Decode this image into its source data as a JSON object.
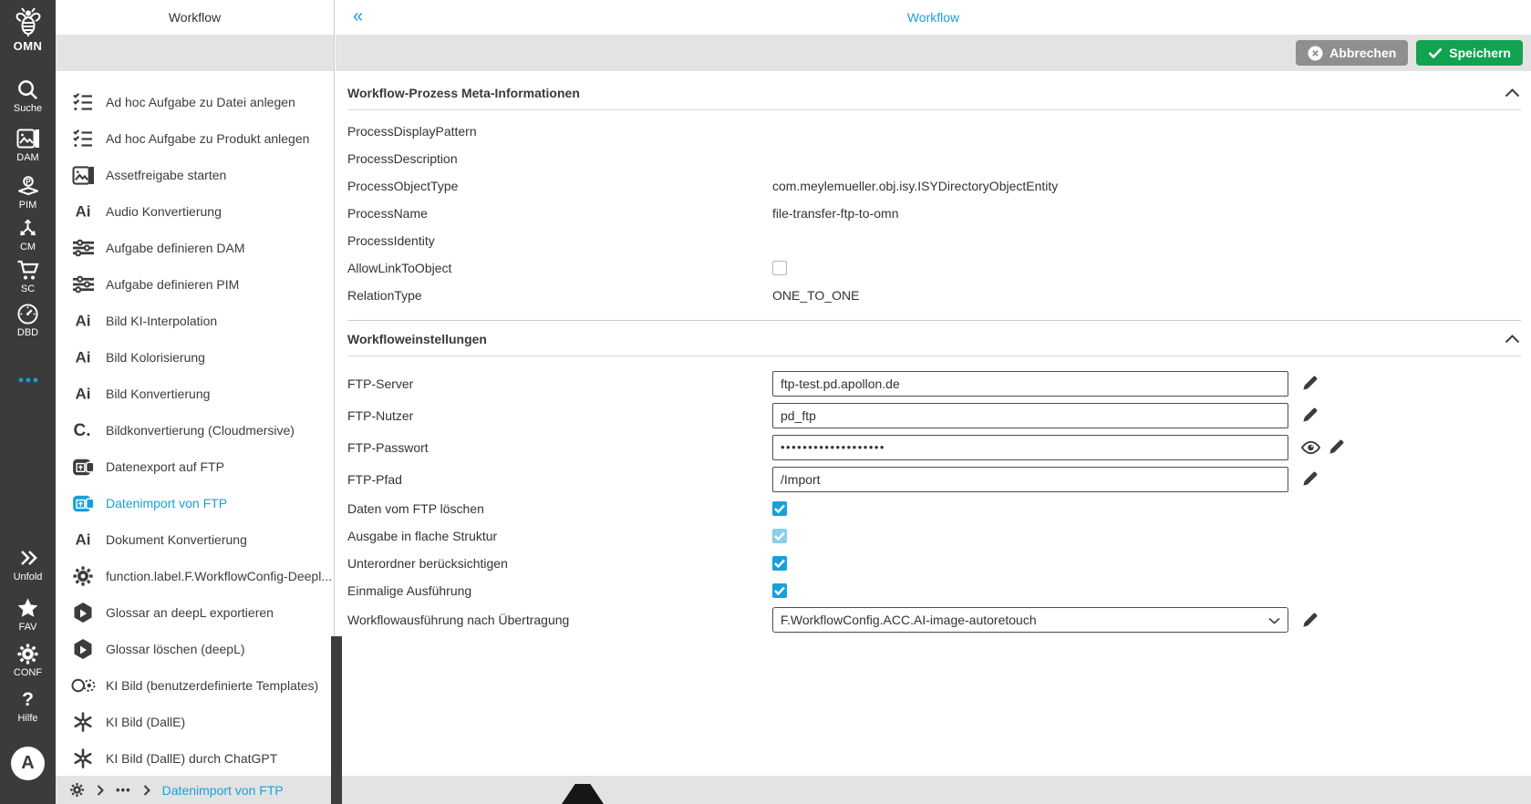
{
  "colors": {
    "accent_blue": "#189fdb",
    "save_green": "#12a350",
    "cancel_gray": "#8f8f8f",
    "sidebar_bg": "#3b3b3b",
    "toolbar_gray": "#e3e3e3",
    "checkbox_blue": "#18a0dc",
    "checkbox_blue_disabled": "#8ccdeb"
  },
  "left_nav": {
    "logo": {
      "icon": "bee-icon",
      "label": "OMN"
    },
    "items": [
      {
        "icon": "search-icon",
        "label": "Suche"
      },
      {
        "icon": "dam-icon",
        "label": "DAM"
      },
      {
        "icon": "pim-icon",
        "label": "PIM"
      },
      {
        "icon": "cm-icon",
        "label": "CM"
      },
      {
        "icon": "cart-icon",
        "label": "SC"
      },
      {
        "icon": "gauge-icon",
        "label": "DBD"
      },
      {
        "icon": "more-dots-icon",
        "label": ""
      }
    ],
    "bottom_items": [
      {
        "icon": "unfold-icon",
        "label": "Unfold"
      },
      {
        "icon": "star-icon",
        "label": "FAV"
      },
      {
        "icon": "gear-icon",
        "label": "CONF"
      },
      {
        "icon": "help-icon",
        "label": "Hilfe"
      }
    ],
    "avatar_letter": "A"
  },
  "workflow_panel": {
    "title": "Workflow",
    "items": [
      {
        "icon": "tasklist-icon",
        "label": "Ad hoc Aufgabe zu Datei anlegen"
      },
      {
        "icon": "tasklist-icon",
        "label": "Ad hoc Aufgabe zu Produkt anlegen"
      },
      {
        "icon": "asset-icon",
        "label": "Assetfreigabe starten"
      },
      {
        "icon": "ai-icon",
        "label": "Audio Konvertierung"
      },
      {
        "icon": "sliders-icon",
        "label": "Aufgabe definieren DAM"
      },
      {
        "icon": "sliders-icon",
        "label": "Aufgabe definieren PIM"
      },
      {
        "icon": "ai-icon",
        "label": "Bild KI-Interpolation"
      },
      {
        "icon": "ai-icon",
        "label": "Bild Kolorisierung"
      },
      {
        "icon": "ai-icon",
        "label": "Bild Konvertierung"
      },
      {
        "icon": "cloudmersive-icon",
        "label": "Bildkonvertierung (Cloudmersive)"
      },
      {
        "icon": "export-ftp-icon",
        "label": "Datenexport auf FTP"
      },
      {
        "icon": "import-ftp-icon",
        "label": "Datenimport von FTP",
        "selected": true
      },
      {
        "icon": "ai-icon",
        "label": "Dokument Konvertierung"
      },
      {
        "icon": "panel-gear-icon",
        "label": "function.label.F.WorkflowConfig-Deepl..."
      },
      {
        "icon": "deepl-icon",
        "label": "Glossar an deepL exportieren"
      },
      {
        "icon": "deepl-icon",
        "label": "Glossar löschen (deepL)"
      },
      {
        "icon": "templates-icon",
        "label": "KI Bild (benutzerdefinierte Templates)"
      },
      {
        "icon": "openai-icon",
        "label": "KI Bild (DallE)"
      },
      {
        "icon": "openai-icon",
        "label": "KI Bild (DallE) durch ChatGPT"
      }
    ]
  },
  "main": {
    "title": "Workflow",
    "toolbar": {
      "cancel_label": "Abbrechen",
      "save_label": "Speichern"
    },
    "sections": [
      {
        "title": "Workflow-Prozess Meta-Informationen",
        "rows": [
          {
            "label": "ProcessDisplayPattern",
            "type": "text",
            "value": ""
          },
          {
            "label": "ProcessDescription",
            "type": "text",
            "value": ""
          },
          {
            "label": "ProcessObjectType",
            "type": "text",
            "value": "com.meylemueller.obj.isy.ISYDirectoryObjectEntity"
          },
          {
            "label": "ProcessName",
            "type": "text",
            "value": "file-transfer-ftp-to-omn"
          },
          {
            "label": "ProcessIdentity",
            "type": "text",
            "value": ""
          },
          {
            "label": "AllowLinkToObject",
            "type": "checkbox",
            "checked": false
          },
          {
            "label": "RelationType",
            "type": "text",
            "value": "ONE_TO_ONE"
          }
        ]
      },
      {
        "title": "Workfloweinstellungen",
        "rows": [
          {
            "label": "FTP-Server",
            "type": "input",
            "value": "ftp-test.pd.apollon.de",
            "actions": [
              "edit"
            ]
          },
          {
            "label": "FTP-Nutzer",
            "type": "input",
            "value": "pd_ftp",
            "actions": [
              "edit"
            ]
          },
          {
            "label": "FTP-Passwort",
            "type": "password",
            "value": "•••••••••••••••••••",
            "actions": [
              "reveal",
              "edit"
            ]
          },
          {
            "label": "FTP-Pfad",
            "type": "input",
            "value": "/Import",
            "actions": [
              "edit"
            ]
          },
          {
            "label": "Daten vom FTP löschen",
            "type": "checkbox",
            "checked": true
          },
          {
            "label": "Ausgabe in flache Struktur",
            "type": "checkbox",
            "checked": true,
            "disabled": true
          },
          {
            "label": "Unterordner berücksichtigen",
            "type": "checkbox",
            "checked": true
          },
          {
            "label": "Einmalige Ausführung",
            "type": "checkbox",
            "checked": true
          },
          {
            "label": "Workflowausführung nach Übertragung",
            "type": "select",
            "value": "F.WorkflowConfig.ACC.AI-image-autoretouch",
            "actions": [
              "edit"
            ]
          }
        ]
      }
    ]
  },
  "breadcrumb": {
    "more": "•••",
    "link": "Datenimport von FTP"
  }
}
